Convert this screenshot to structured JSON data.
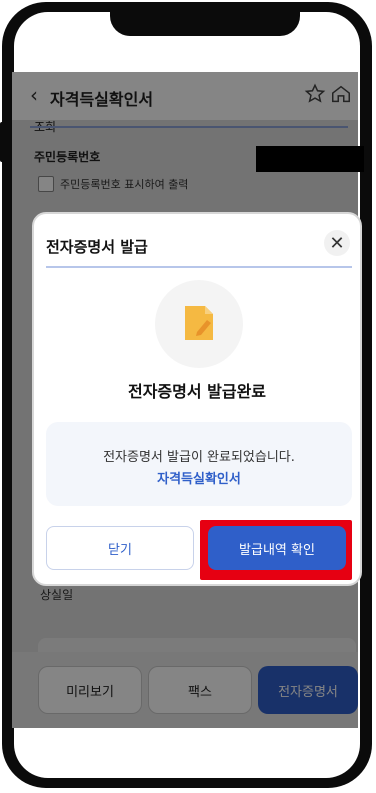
{
  "header": {
    "title": "자격득실확인서",
    "back_icon": "chevron-left-icon",
    "star_icon": "star-icon",
    "home_icon": "home-icon"
  },
  "form": {
    "prev_field_text": "조회",
    "rrn_label": "주민등록번호",
    "rrn_checkbox_label": "주민등록번호 표시하여 출력",
    "section_label": "상실일"
  },
  "bottom_bar": {
    "preview": "미리보기",
    "fax": "팩스",
    "certificate": "전자증명서"
  },
  "modal": {
    "title": "전자증명서 발급",
    "close_glyph": "✕",
    "done_title": "전자증명서 발급완료",
    "message": "전자증명서 발급이 완료되었습니다.",
    "doc_name": "자격득실확인서",
    "close_button": "닫기",
    "confirm_button": "발급내역 확인"
  },
  "colors": {
    "accent": "#2f5fc9",
    "highlight": "#e60012",
    "icon": "#f5b942"
  }
}
